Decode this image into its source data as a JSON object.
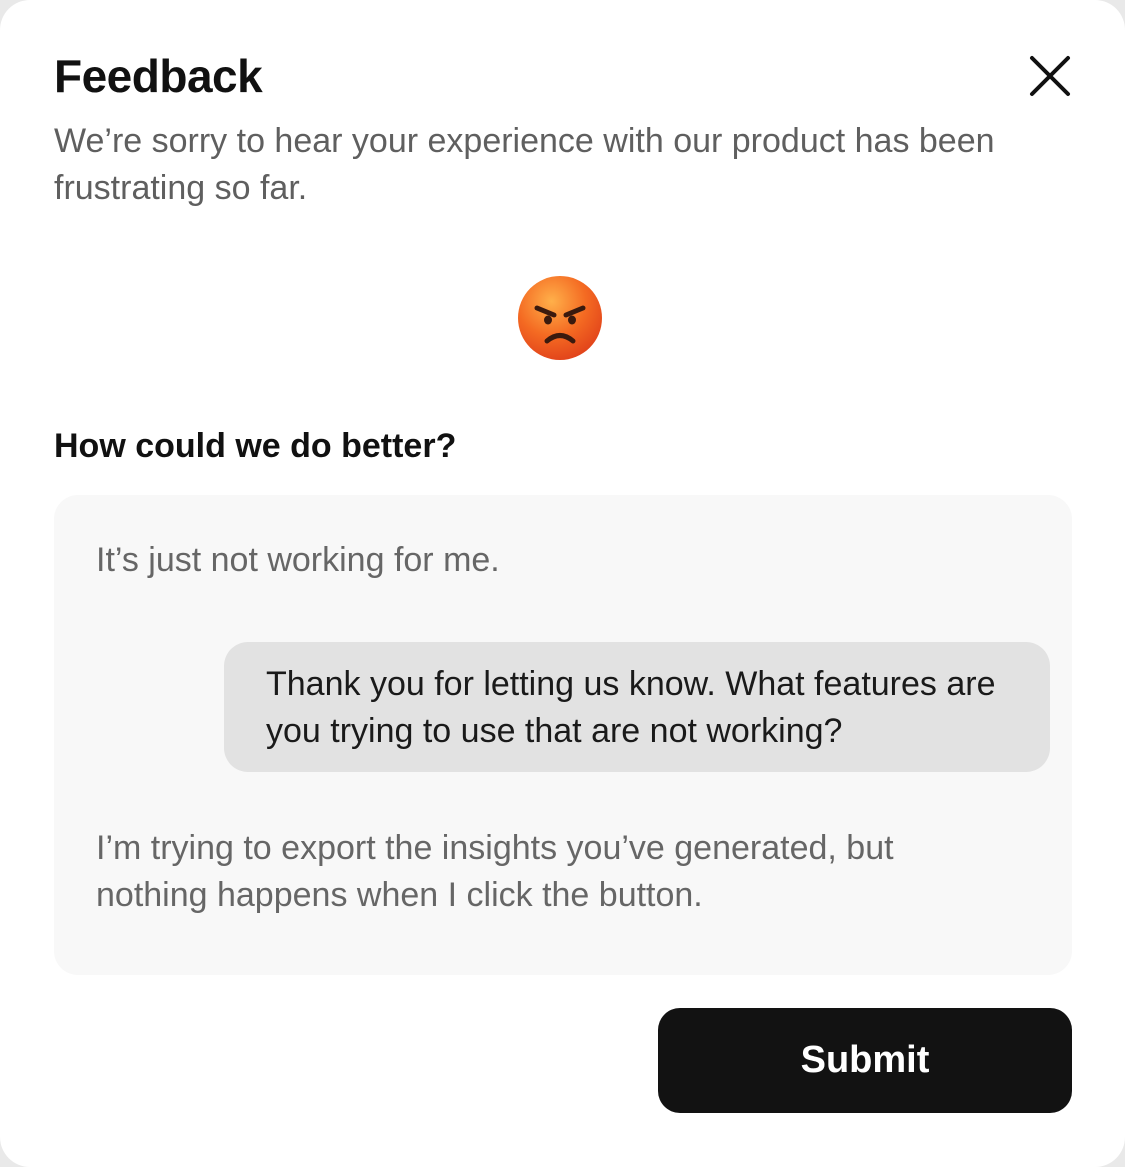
{
  "dialog": {
    "title": "Feedback",
    "subtitle": "We’re sorry to hear your experience with our product has been frustrating so far.",
    "close_icon": "close-icon",
    "mood_icon": "angry-face-emoji"
  },
  "question": {
    "label": "How could we do better?"
  },
  "conversation": {
    "messages": [
      {
        "role": "user",
        "text": "It’s just not working for me."
      },
      {
        "role": "assistant",
        "text": "Thank you for letting us know. What features are you trying to use that are not working?"
      },
      {
        "role": "user",
        "text": "I’m trying to export the insights you’ve generated, but nothing happens when I click the button."
      }
    ]
  },
  "actions": {
    "submit_label": "Submit"
  },
  "colors": {
    "background": "#ffffff",
    "chat_background": "#f8f8f8",
    "assistant_bubble": "#e2e2e2",
    "button": "#121212",
    "emoji_face": "#ee5a1e"
  }
}
